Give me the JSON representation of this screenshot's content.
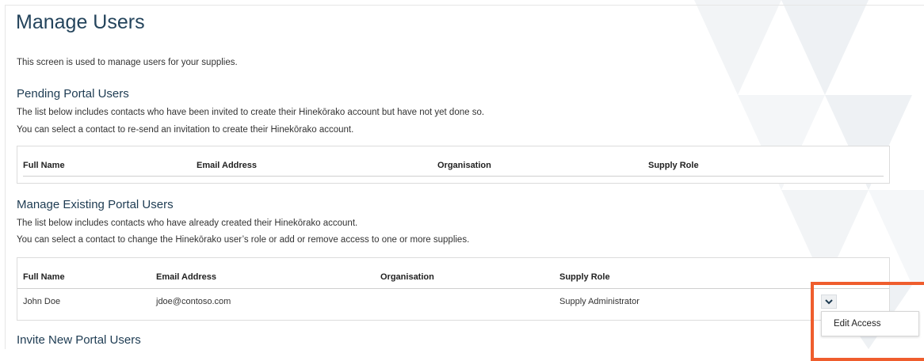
{
  "page": {
    "title": "Manage Users",
    "intro": "This screen is used to manage users for your supplies."
  },
  "pending": {
    "title": "Pending Portal Users",
    "desc1": "The list below includes contacts who have been invited to create their Hinekōrako account but have not yet done so.",
    "desc2": "You can select a contact to re-send an invitation to create their Hinekōrako account.",
    "columns": [
      "Full Name",
      "Email Address",
      "Organisation",
      "Supply Role"
    ]
  },
  "existing": {
    "title": "Manage Existing Portal Users",
    "desc1": "The list below includes contacts who have already created their Hinekōrako account.",
    "desc2": "You can select a contact to change the Hinekōrako user’s role or add or remove access to one or more supplies.",
    "columns": [
      "Full Name",
      "Email Address",
      "Organisation",
      "Supply Role"
    ],
    "rows": [
      {
        "full_name": "John Doe",
        "email": "jdoe@contoso.com",
        "organisation": "",
        "supply_role": "Supply Administrator"
      }
    ]
  },
  "row_menu": {
    "icon": "chevron-down-icon",
    "items": [
      "Edit Access"
    ]
  },
  "invite": {
    "title": "Invite New Portal Users"
  },
  "colors": {
    "heading": "#24445c",
    "highlight": "#ef5d2d"
  }
}
